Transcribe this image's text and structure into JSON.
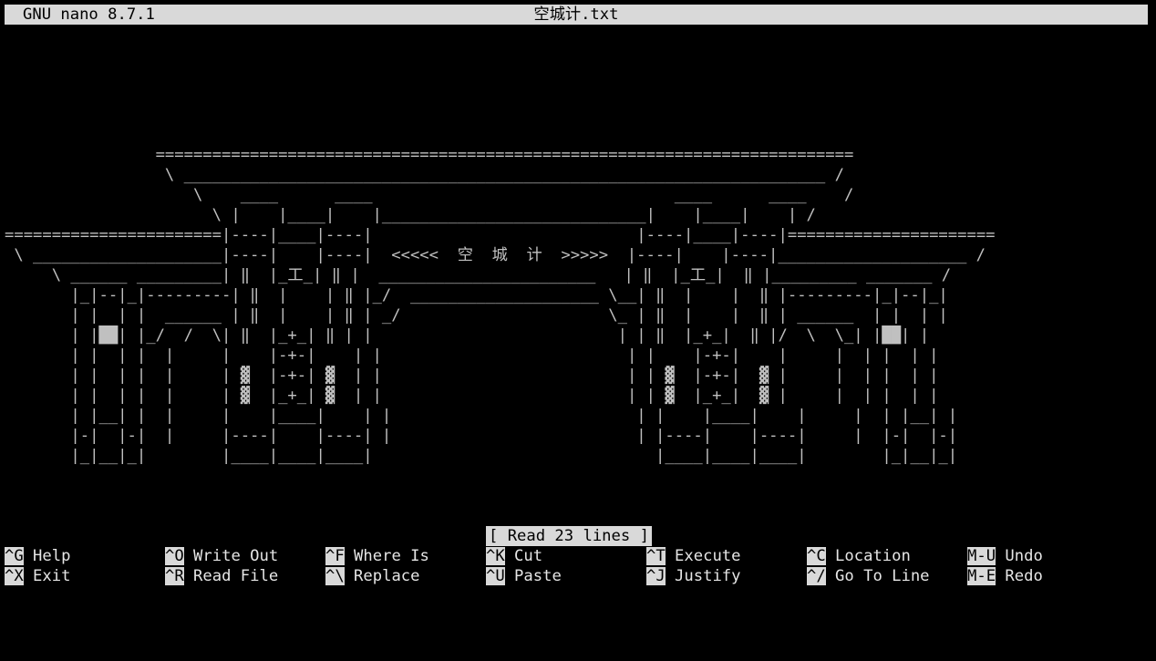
{
  "titlebar": {
    "app": "GNU nano 8.7.1",
    "filename": "空城计.txt"
  },
  "art_lines": [
    "",
    "",
    "",
    "",
    "",
    "                ==========================================================================",
    "                 \\ ____________________________________________________________________ /",
    "                    \\    ____      ____                                ____      ____    /",
    "                      \\ |    |____|    |____________________________|    |____|    | /",
    "=======================|----|____|----|                            |----|____|----|======================",
    " \\ ____________________|----|    |----|  <<<<<  空  城  计  >>>>>  |----|    |----|____________________ /",
    "     \\ ______ _________| ‖  |_工_| ‖ |  _______________________   | ‖  |_工_|  ‖ |_________ _______ /",
    "       |_|--|_|---------| ‖  |    | ‖ |_/  ____________________ \\__| ‖  |    |  ‖ |---------|_|--|_|",
    "       | |  | |  ______ | ‖  |    | ‖ | _/                      \\_ | ‖  |    |  ‖ | ______  | |  | |",
    "       | |██| |_/  /  \\| ‖  |_+_| ‖ | |                          | | ‖  |_+_|  ‖ |/  \\  \\_| |██| |",
    "       | |  | |  |     |    |-+-|    | |                          | |    |-+-|    |     |  | |  | |",
    "       | |  | |  |     | ▓  |-+-| ▓  | |                          | | ▓  |-+-|  ▓ |     |  | |  | |",
    "       | |  | |  |     | ▓  |_+_| ▓  | |                          | | ▓  |_+_|  ▓ |     |  | |  | |",
    "       | |__| |  |     |    |____|    | |                          | |    |____|    |     |  | |__| |",
    "       |-|  |-|  |     |----|    |----| |                          | |----|    |----|     |  |-|  |-|",
    "       |_|__|_|        |____|____|____|                              |____|____|____|        |_|__|_|",
    "",
    "",
    ""
  ],
  "status": "[ Read 23 lines ]",
  "shortcuts": [
    {
      "key": "^G",
      "label": "Help"
    },
    {
      "key": "^O",
      "label": "Write Out"
    },
    {
      "key": "^F",
      "label": "Where Is"
    },
    {
      "key": "^K",
      "label": "Cut"
    },
    {
      "key": "^T",
      "label": "Execute"
    },
    {
      "key": "^C",
      "label": "Location"
    },
    {
      "key": "M-U",
      "label": "Undo"
    },
    {
      "key": "^X",
      "label": "Exit"
    },
    {
      "key": "^R",
      "label": "Read File"
    },
    {
      "key": "^\\",
      "label": "Replace"
    },
    {
      "key": "^U",
      "label": "Paste"
    },
    {
      "key": "^J",
      "label": "Justify"
    },
    {
      "key": "^/",
      "label": "Go To Line"
    },
    {
      "key": "M-E",
      "label": "Redo"
    }
  ],
  "colors": {
    "titlebar_bg": "#d9d9d9",
    "cursor": "#00c000",
    "accent_cyan": "#a8dde6"
  }
}
